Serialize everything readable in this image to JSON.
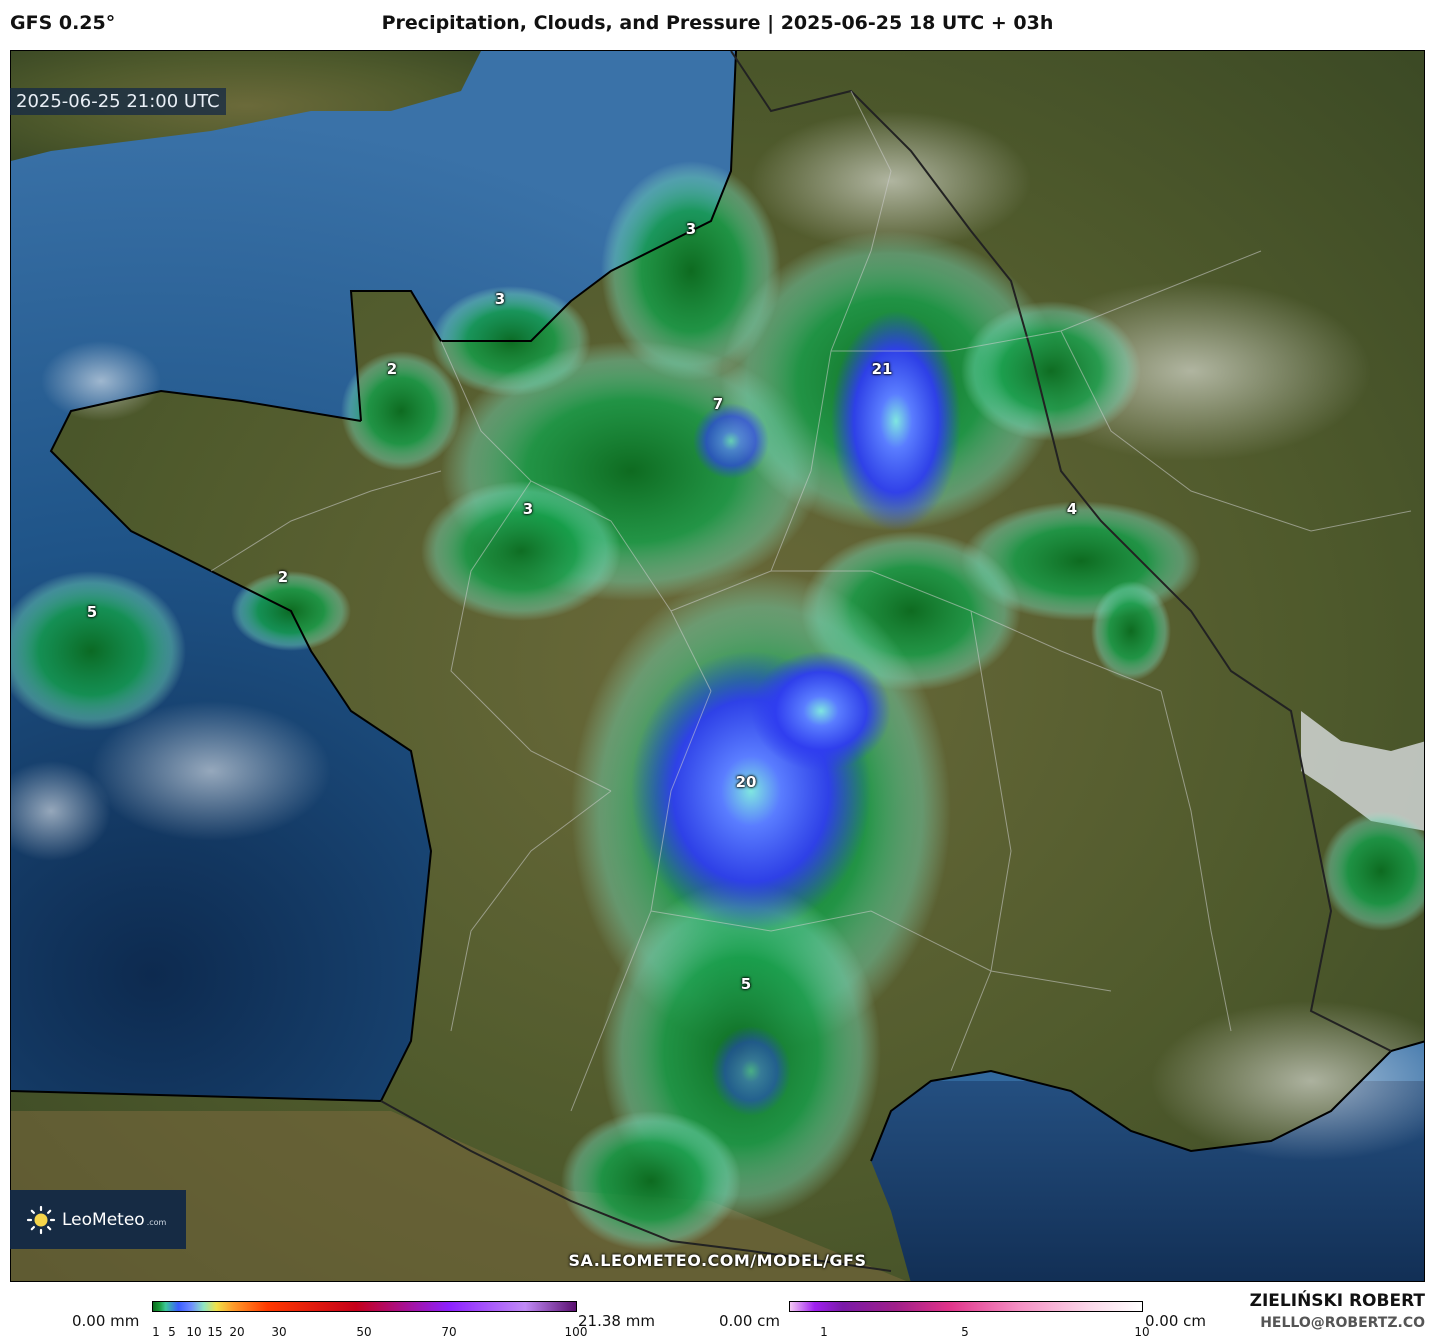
{
  "header": {
    "model": "GFS 0.25°",
    "title": "Precipitation, Clouds, and Pressure | 2025-06-25 18 UTC + 03h"
  },
  "map": {
    "timestamp": "2025-06-25 21:00 UTC",
    "region": "France",
    "precip_labels": [
      {
        "value": "3"
      },
      {
        "value": "3"
      },
      {
        "value": "2"
      },
      {
        "value": "7"
      },
      {
        "value": "21"
      },
      {
        "value": "3"
      },
      {
        "value": "4"
      },
      {
        "value": "2"
      },
      {
        "value": "5"
      },
      {
        "value": "20"
      },
      {
        "value": "5"
      }
    ],
    "footer_url": "SA.LEOMETEO.COM/MODEL/GFS",
    "logo_text": "LeoMeteo",
    "logo_suffix": ".com"
  },
  "legend": {
    "precip": {
      "min_label": "0.00 mm",
      "max_label": "21.38 mm",
      "ticks": [
        "1",
        "5",
        "10",
        "15",
        "20",
        "30",
        "50",
        "70",
        "100"
      ]
    },
    "snow": {
      "min_label": "0.00 cm",
      "max_label": "0.00 cm",
      "ticks": [
        "1",
        "5",
        "10"
      ]
    }
  },
  "credits": {
    "author": "ZIELIŃSKI ROBERT",
    "email": "HELLO@ROBERTZ.CO"
  },
  "colors": {
    "sea": "#1d4f86",
    "land": "#4d5a2c",
    "precip_green": "#0a7a2a",
    "precip_blue": "#3350ff"
  }
}
